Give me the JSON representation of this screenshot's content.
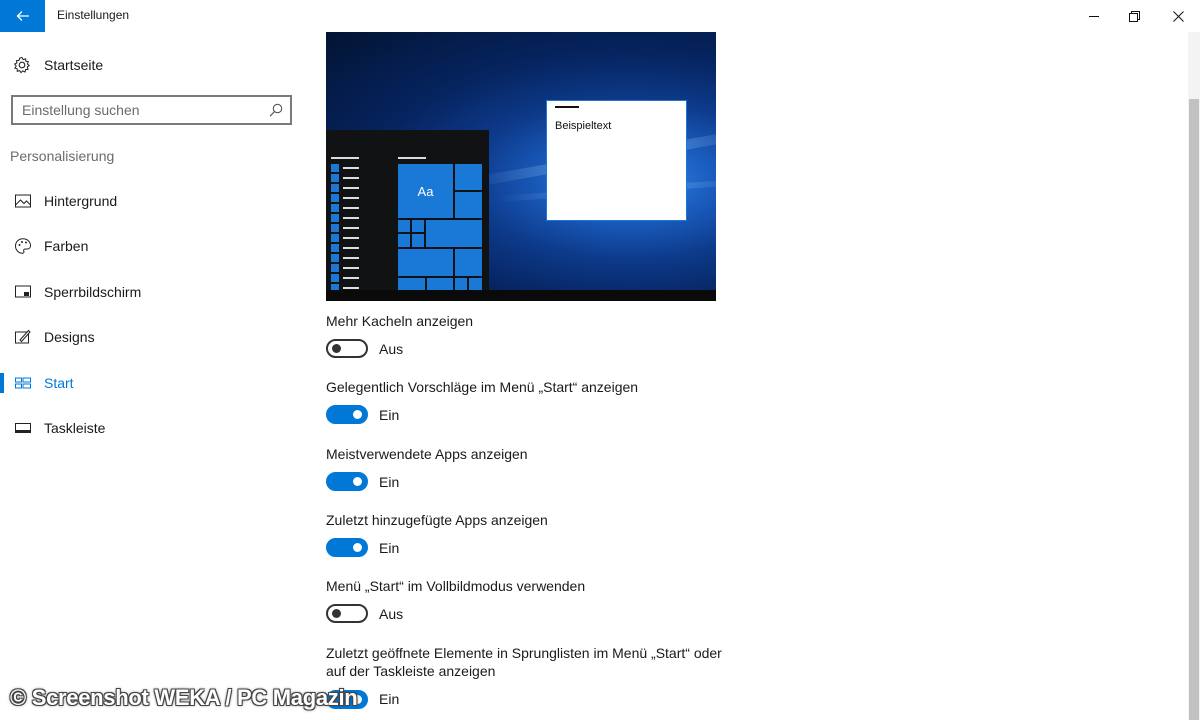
{
  "window": {
    "title": "Einstellungen",
    "controls": {
      "minimize": "minimize-icon",
      "maximize": "restore-icon",
      "close": "close-icon"
    }
  },
  "sidebar": {
    "home_label": "Startseite",
    "search": {
      "placeholder": "Einstellung suchen",
      "value": ""
    },
    "section": "Personalisierung",
    "items": [
      {
        "label": "Hintergrund",
        "icon": "picture-icon"
      },
      {
        "label": "Farben",
        "icon": "palette-icon"
      },
      {
        "label": "Sperrbildschirm",
        "icon": "lockscreen-icon"
      },
      {
        "label": "Designs",
        "icon": "designs-icon"
      },
      {
        "label": "Start",
        "icon": "start-icon",
        "selected": true
      },
      {
        "label": "Taskleiste",
        "icon": "taskbar-icon"
      }
    ]
  },
  "preview": {
    "sample_text": "Beispieltext",
    "tile_label": "Aa"
  },
  "settings": [
    {
      "label": "Mehr Kacheln anzeigen",
      "on": false,
      "state": "Aus"
    },
    {
      "label": "Gelegentlich Vorschläge im Menü „Start“ anzeigen",
      "on": true,
      "state": "Ein"
    },
    {
      "label": "Meistverwendete Apps anzeigen",
      "on": true,
      "state": "Ein"
    },
    {
      "label": "Zuletzt hinzugefügte Apps anzeigen",
      "on": true,
      "state": "Ein"
    },
    {
      "label": "Menü „Start“ im Vollbildmodus verwenden",
      "on": false,
      "state": "Aus"
    },
    {
      "label": "Zuletzt geöffnete Elemente in Sprunglisten im Menü „Start“ oder auf der Taskleiste anzeigen",
      "on": true,
      "state": "Ein"
    }
  ],
  "colors": {
    "accent": "#0078d7",
    "tile": "#1a78d6"
  },
  "watermark": "© Screenshot WEKA / PC Magazin"
}
